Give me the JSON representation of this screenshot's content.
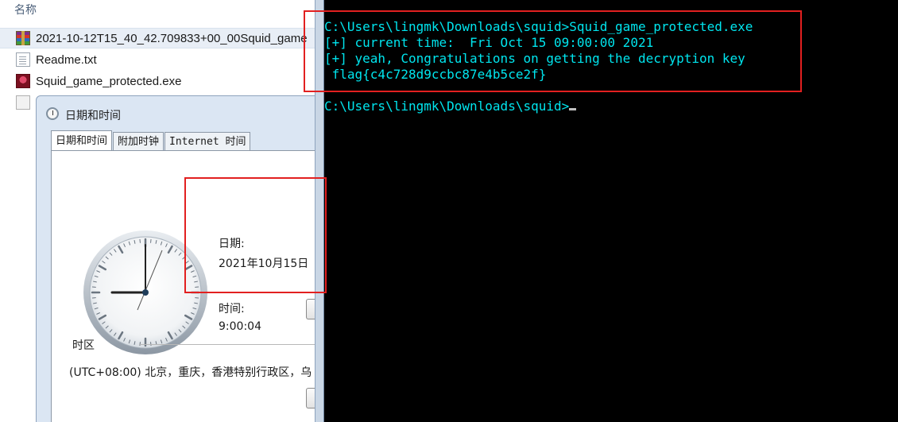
{
  "explorer": {
    "column_name": "名称",
    "files": [
      {
        "name": "2021-10-12T15_40_42.709833+00_00Squid_game",
        "icon": "winrar-archive-icon"
      },
      {
        "name": "Readme.txt",
        "icon": "text-file-icon"
      },
      {
        "name": "Squid_game_protected.exe",
        "icon": "exe-file-icon"
      }
    ]
  },
  "dialog": {
    "title": "日期和时间",
    "tabs": [
      "日期和时间",
      "附加时钟",
      "Internet 时间"
    ],
    "date_label": "日期:",
    "date_value": "2021年10月15日",
    "time_label": "时间:",
    "time_value": "9:00:04",
    "timezone_label": "时区",
    "timezone_value": "(UTC+08:00) 北京，重庆，香港特别行政区，乌"
  },
  "console": {
    "lines": [
      "C:\\Users\\lingmk\\Downloads\\squid>Squid_game_protected.exe",
      "[+] current time:  Fri Oct 15 09:00:00 2021",
      "[+] yeah, Congratulations on getting the decryption key",
      " flag{c4c728d9ccbc87e4b5ce2f}",
      "C:\\Users\\lingmk\\Downloads\\squid>"
    ]
  },
  "colors": {
    "console_text": "#00e5ee",
    "console_bg": "#000000",
    "highlight": "#e22020"
  }
}
